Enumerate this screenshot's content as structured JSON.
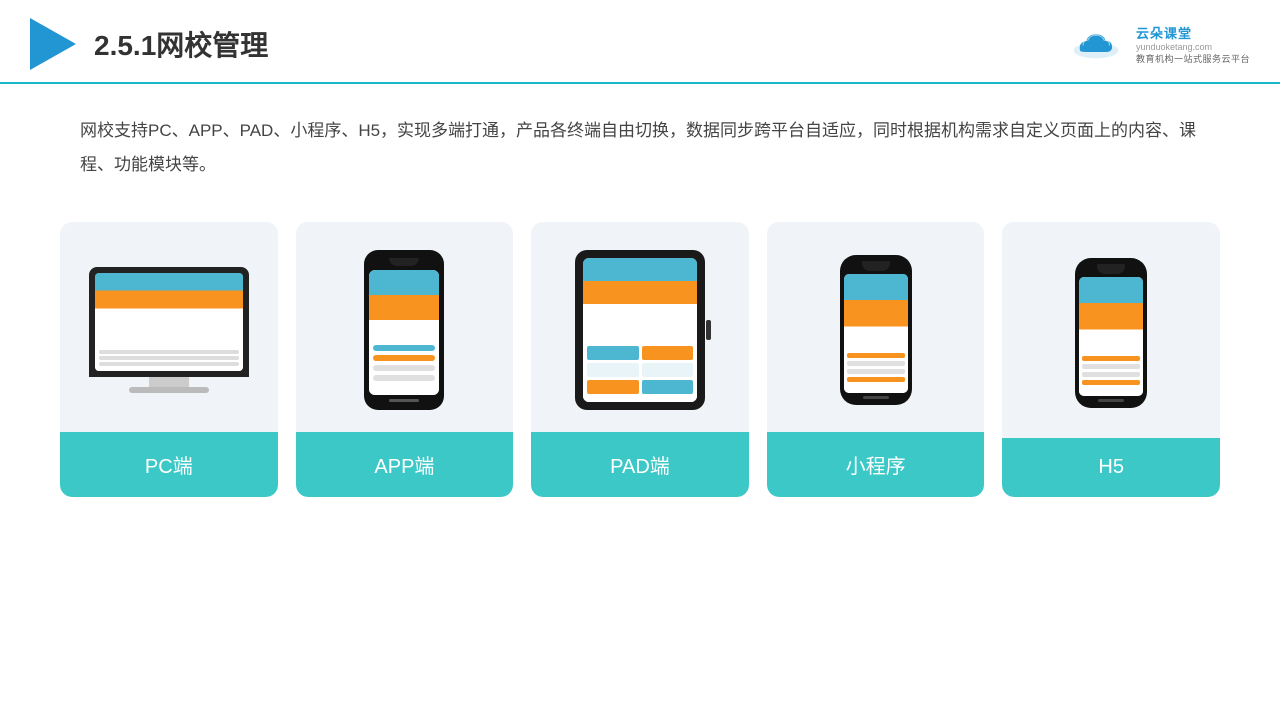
{
  "header": {
    "title": "2.5.1网校管理",
    "brand_name": "云朵课堂",
    "brand_url": "yunduoketang.com",
    "brand_sub1": "教育机构一站",
    "brand_sub2": "式服务云平台"
  },
  "description": {
    "text": "网校支持PC、APP、PAD、小程序、H5，实现多端打通，产品各终端自由切换，数据同步跨平台自适应，同时根据机构需求自定义页面上的内容、课程、功能模块等。"
  },
  "cards": [
    {
      "id": "pc",
      "label": "PC端"
    },
    {
      "id": "app",
      "label": "APP端"
    },
    {
      "id": "pad",
      "label": "PAD端"
    },
    {
      "id": "miniprogram",
      "label": "小程序"
    },
    {
      "id": "h5",
      "label": "H5"
    }
  ]
}
